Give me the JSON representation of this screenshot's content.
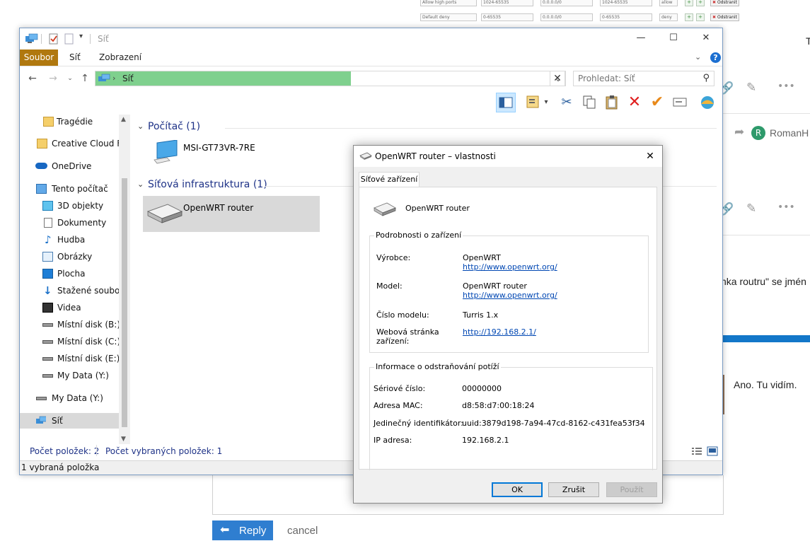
{
  "background": {
    "fw_rows": [
      {
        "name": "Allow high ports",
        "range1": "1024-65535",
        "ip": "0.0.0.0/0",
        "range2": "1024-65535",
        "action": "allow"
      },
      {
        "name": "Default deny",
        "range1": "0-65535",
        "ip": "0.0.0.0/0",
        "range2": "0-65535",
        "action": "deny"
      }
    ],
    "fw_delete_label": "Odstranit",
    "plus_glyph": "+",
    "right_edge_char": "T",
    "author_initial": "R",
    "author_name": "RomanH",
    "snippet_text": "nka routru\" se jmén",
    "comment_text": "Ano. Tu vidím.",
    "reply_label": "Reply",
    "cancel_label": "cancel"
  },
  "explorer": {
    "title": "Síť",
    "window_controls": {
      "minimize": "—",
      "maximize": "☐",
      "close": "✕"
    },
    "ribbon_tabs": [
      "Soubor",
      "Síť",
      "Zobrazení"
    ],
    "address_crumb": "Síť",
    "search_placeholder": "Prohledat: Síť",
    "nav_items": [
      "Tragédie",
      "Creative Cloud Fil",
      "OneDrive",
      "Tento počítač",
      "3D objekty",
      "Dokumenty",
      "Hudba",
      "Obrázky",
      "Plocha",
      "Stažené soubory",
      "Videa",
      "Místní disk (B:)",
      "Místní disk (C:)",
      "Místní disk (E:)",
      "My Data (Y:)",
      "My Data (Y:)",
      "Síť"
    ],
    "groups": [
      {
        "header": "Počítač (1)",
        "item": "MSI-GT73VR-7RE"
      },
      {
        "header": "Síťová infrastruktura (1)",
        "item": "OpenWRT router"
      }
    ],
    "status_count": "Počet položek: 2",
    "status_selected_count": "Počet vybraných položek: 1",
    "status_selected": "1 vybraná položka"
  },
  "dialog": {
    "title": "OpenWRT router – vlastnosti",
    "tab": "Síťové zařízení",
    "device_name": "OpenWRT router",
    "details_legend": "Podrobnosti o zařízení",
    "details": {
      "manufacturer_label": "Výrobce:",
      "manufacturer_value": "OpenWRT",
      "manufacturer_url": "http://www.openwrt.org/",
      "model_label": "Model:",
      "model_value": "OpenWRT router",
      "model_url": "http://www.openwrt.org/",
      "model_number_label": "Číslo modelu:",
      "model_number_value": "Turris 1.x",
      "webpage_label_1": "Webová stránka",
      "webpage_label_2": "zařízení:",
      "webpage_url": "http://192.168.2.1/"
    },
    "troubleshoot_legend": "Informace o odstraňování potíží",
    "troubleshoot": {
      "serial_label": "Sériové číslo:",
      "serial_value": "00000000",
      "mac_label": "Adresa MAC:",
      "mac_value": "d8:58:d7:00:18:24",
      "uid_label": "Jedinečný identifikátor:",
      "uid_value": "uuid:3879d198-7a94-47cd-8162-c431fea53f34",
      "ip_label": "IP adresa:",
      "ip_value": "192.168.2.1"
    },
    "buttons": {
      "ok": "OK",
      "cancel": "Zrušit",
      "apply": "Použít"
    }
  },
  "colors": {
    "file_tab": "#b0780f",
    "address_progress": "#7fd08e",
    "header_blue": "#1e3287",
    "link": "#0047b3",
    "reply_button": "#2f7ed0"
  }
}
